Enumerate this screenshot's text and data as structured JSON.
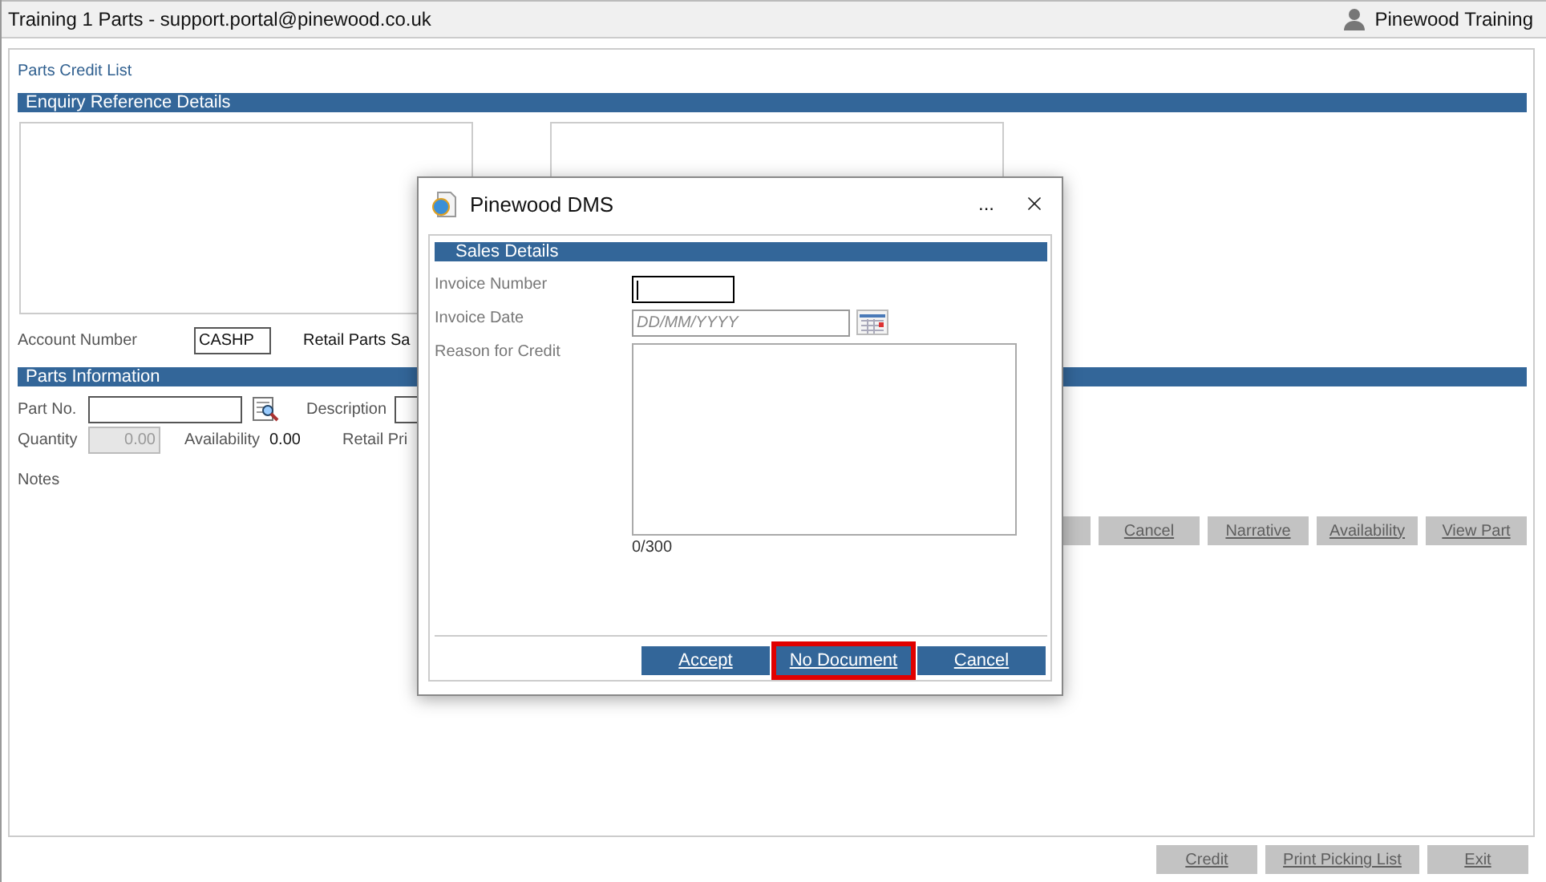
{
  "window": {
    "title": "Training 1 Parts - support.portal@pinewood.co.uk",
    "user": "Pinewood Training"
  },
  "page": {
    "title": "Parts Credit List",
    "enquiry": {
      "header": "Enquiry Reference Details",
      "account_label": "Account Number",
      "account_value": "CASHP",
      "retail_label": "Retail Parts Sa"
    },
    "parts": {
      "header": "Parts Information",
      "part_no_label": "Part No.",
      "description_label": "Description",
      "quantity_label": "Quantity",
      "quantity_value": "0.00",
      "availability_label": "Availability",
      "availability_value": "0.00",
      "retail_price_label": "Retail Pri",
      "notes_label": "Notes"
    },
    "actions": [
      {
        "label": "Cancel",
        "disabled": true
      },
      {
        "label": "Narrative",
        "disabled": true
      },
      {
        "label": "Availability",
        "disabled": true
      },
      {
        "label": "View Part",
        "disabled": true
      }
    ]
  },
  "footer": [
    {
      "label": "Credit",
      "disabled": true
    },
    {
      "label": "Print Picking List",
      "disabled": true
    },
    {
      "label": "Exit",
      "disabled": true
    }
  ],
  "dialog": {
    "title": "Pinewood DMS",
    "more": "...",
    "section": "Sales Details",
    "fields": [
      {
        "kind": "text",
        "label": "Invoice Number",
        "focused": true
      },
      {
        "kind": "date",
        "label": "Invoice Date",
        "placeholder": "DD/MM/YYYY"
      },
      {
        "kind": "textarea",
        "label": "Reason for Credit",
        "counter": "0/300"
      }
    ],
    "buttons": [
      {
        "label": "Accept",
        "highlighted": false
      },
      {
        "label": "No Document",
        "highlighted": true
      },
      {
        "label": "Cancel",
        "highlighted": false
      }
    ]
  }
}
